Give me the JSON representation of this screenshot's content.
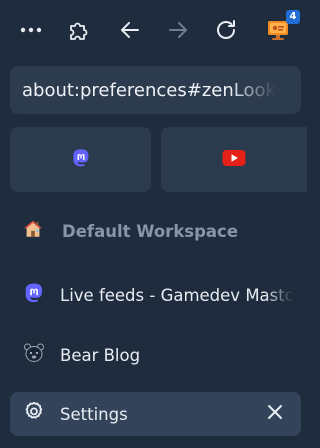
{
  "toolbar": {
    "menu_icon": "more-horizontal-icon",
    "extensions_icon": "puzzle-piece-icon",
    "back_icon": "arrow-left-icon",
    "forward_icon": "arrow-right-icon",
    "reload_icon": "reload-icon",
    "extension_badge_count": "4"
  },
  "urlbar": {
    "value": "about:preferences#zenLook"
  },
  "pinned_tabs": [
    {
      "icon": "mastodon-icon",
      "color": "#6364ff"
    },
    {
      "icon": "youtube-icon",
      "color": "#e62117"
    }
  ],
  "workspace": {
    "icon": "house-icon",
    "label": "Default Workspace"
  },
  "tabs": [
    {
      "icon": "mastodon-icon",
      "label": "Live feeds - Gamedev Mastodon",
      "active": false
    },
    {
      "icon": "bear-icon",
      "label": "Bear Blog",
      "active": false
    },
    {
      "icon": "gear-icon",
      "label": "Settings",
      "active": true
    }
  ],
  "colors": {
    "background": "#1f2c3d",
    "surface": "#2c3b4e",
    "active_tab": "#33445a",
    "muted_text": "#8695a8",
    "badge": "#1f6fd6"
  }
}
